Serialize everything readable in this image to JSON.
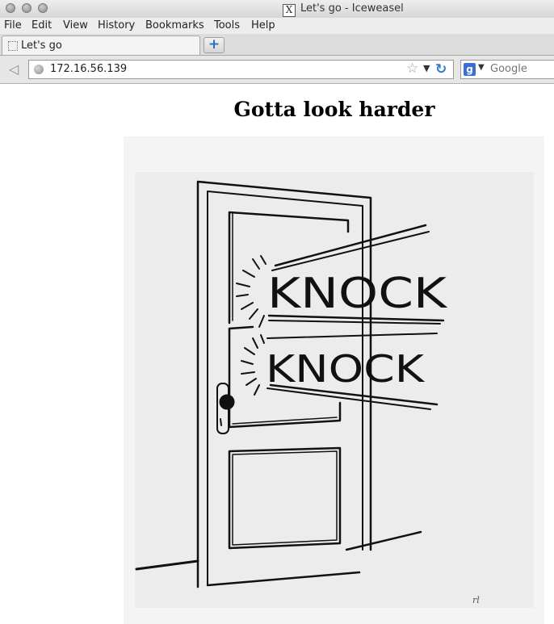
{
  "window": {
    "title": "Let's go - Iceweasel"
  },
  "menu": [
    "File",
    "Edit",
    "View",
    "History",
    "Bookmarks",
    "Tools",
    "Help"
  ],
  "tab": {
    "label": "Let's go"
  },
  "navigation": {
    "url": "172.16.56.139",
    "search_placeholder": "Google"
  },
  "page": {
    "heading": "Gotta look harder",
    "image": {
      "knock_1": "KNOCK",
      "knock_2": "KNOCK",
      "signature": "rl"
    }
  },
  "icons": [
    "close-icon",
    "minimize-icon",
    "maximize-icon",
    "x-window-icon",
    "tab-favicon",
    "new-tab-icon",
    "back-arrow-icon",
    "globe-icon",
    "bookmark-star-icon",
    "url-dropdown-icon",
    "reload-icon",
    "google-search-icon",
    "search-engine-dropdown-icon"
  ]
}
